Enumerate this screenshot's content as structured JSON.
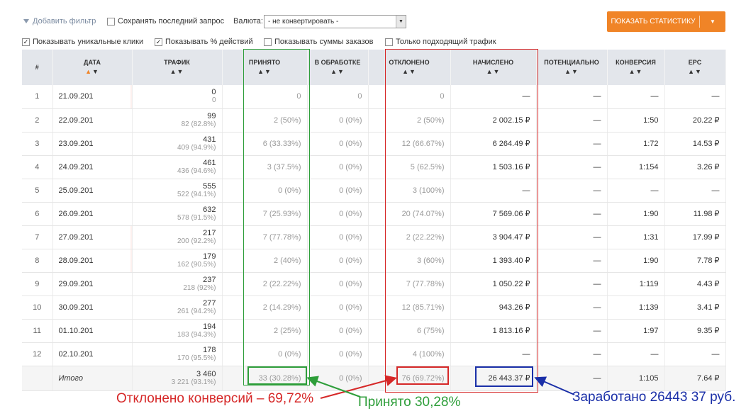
{
  "toolbar": {
    "add_filter": "Добавить фильтр",
    "save_query": "Сохранять последний запрос",
    "currency_label": "Валюта:",
    "currency_value": "- не конвертировать -",
    "show_stats": "ПОКАЗАТЬ СТАТИСТИКУ",
    "unique_clicks": "Показывать уникальные клики",
    "show_percent": "Показывать % действий",
    "show_order_sums": "Показывать суммы заказов",
    "suitable_traffic": "Только подходящий трафик"
  },
  "columns": [
    "#",
    "ДАТА",
    "ТРАФИК",
    "ПРИНЯТО",
    "В ОБРАБОТКЕ",
    "ОТКЛОНЕНО",
    "НАЧИСЛЕНО",
    "ПОТЕНЦИАЛЬНО",
    "КОНВЕРСИЯ",
    "EPC"
  ],
  "rows": [
    {
      "n": "1",
      "date": "21.09.201",
      "pink": true,
      "traffic": "0",
      "traffic_sub": "0",
      "accepted": "0",
      "processing": "0",
      "rejected": "0",
      "credited": "—",
      "potential": "—",
      "conversion": "—",
      "epc": "—"
    },
    {
      "n": "2",
      "date": "22.09.201",
      "pink": false,
      "traffic": "99",
      "traffic_sub": "82 (82.8%)",
      "accepted": "2 (50%)",
      "processing": "0 (0%)",
      "rejected": "2 (50%)",
      "credited": "2 002.15 ₽",
      "potential": "—",
      "conversion": "1:50",
      "epc": "20.22 ₽"
    },
    {
      "n": "3",
      "date": "23.09.201",
      "pink": false,
      "traffic": "431",
      "traffic_sub": "409 (94.9%)",
      "accepted": "6 (33.33%)",
      "processing": "0 (0%)",
      "rejected": "12 (66.67%)",
      "credited": "6 264.49 ₽",
      "potential": "—",
      "conversion": "1:72",
      "epc": "14.53 ₽"
    },
    {
      "n": "4",
      "date": "24.09.201",
      "pink": false,
      "traffic": "461",
      "traffic_sub": "436 (94.6%)",
      "accepted": "3 (37.5%)",
      "processing": "0 (0%)",
      "rejected": "5 (62.5%)",
      "credited": "1 503.16 ₽",
      "potential": "—",
      "conversion": "1:154",
      "epc": "3.26 ₽"
    },
    {
      "n": "5",
      "date": "25.09.201",
      "pink": false,
      "traffic": "555",
      "traffic_sub": "522 (94.1%)",
      "accepted": "0 (0%)",
      "processing": "0 (0%)",
      "rejected": "3 (100%)",
      "credited": "—",
      "potential": "—",
      "conversion": "—",
      "epc": "—"
    },
    {
      "n": "6",
      "date": "26.09.201",
      "pink": false,
      "traffic": "632",
      "traffic_sub": "578 (91.5%)",
      "accepted": "7 (25.93%)",
      "processing": "0 (0%)",
      "rejected": "20 (74.07%)",
      "credited": "7 569.06 ₽",
      "potential": "—",
      "conversion": "1:90",
      "epc": "11.98 ₽"
    },
    {
      "n": "7",
      "date": "27.09.201",
      "pink": true,
      "traffic": "217",
      "traffic_sub": "200 (92.2%)",
      "accepted": "7 (77.78%)",
      "processing": "0 (0%)",
      "rejected": "2 (22.22%)",
      "credited": "3 904.47 ₽",
      "potential": "—",
      "conversion": "1:31",
      "epc": "17.99 ₽"
    },
    {
      "n": "8",
      "date": "28.09.201",
      "pink": true,
      "traffic": "179",
      "traffic_sub": "162 (90.5%)",
      "accepted": "2 (40%)",
      "processing": "0 (0%)",
      "rejected": "3 (60%)",
      "credited": "1 393.40 ₽",
      "potential": "—",
      "conversion": "1:90",
      "epc": "7.78 ₽"
    },
    {
      "n": "9",
      "date": "29.09.201",
      "pink": false,
      "traffic": "237",
      "traffic_sub": "218 (92%)",
      "accepted": "2 (22.22%)",
      "processing": "0 (0%)",
      "rejected": "7 (77.78%)",
      "credited": "1 050.22 ₽",
      "potential": "—",
      "conversion": "1:119",
      "epc": "4.43 ₽"
    },
    {
      "n": "10",
      "date": "30.09.201",
      "pink": false,
      "traffic": "277",
      "traffic_sub": "261 (94.2%)",
      "accepted": "2 (14.29%)",
      "processing": "0 (0%)",
      "rejected": "12 (85.71%)",
      "credited": "943.26 ₽",
      "potential": "—",
      "conversion": "1:139",
      "epc": "3.41 ₽"
    },
    {
      "n": "11",
      "date": "01.10.201",
      "pink": false,
      "traffic": "194",
      "traffic_sub": "183 (94.3%)",
      "accepted": "2 (25%)",
      "processing": "0 (0%)",
      "rejected": "6 (75%)",
      "credited": "1 813.16 ₽",
      "potential": "—",
      "conversion": "1:97",
      "epc": "9.35 ₽"
    },
    {
      "n": "12",
      "date": "02.10.201",
      "pink": false,
      "traffic": "178",
      "traffic_sub": "170 (95.5%)",
      "accepted": "0 (0%)",
      "processing": "0 (0%)",
      "rejected": "4 (100%)",
      "credited": "—",
      "potential": "—",
      "conversion": "—",
      "epc": "—"
    }
  ],
  "total": {
    "label": "Итого",
    "traffic": "3 460",
    "traffic_sub": "3 221 (93.1%)",
    "accepted": "33 (30.28%)",
    "processing": "0 (0%)",
    "rejected": "76 (69.72%)",
    "credited": "26 443.37 ₽",
    "potential": "—",
    "conversion": "1:105",
    "epc": "7.64 ₽"
  },
  "annotations": {
    "rejected": "Отклонено конверсий – 69,72%",
    "accepted": "Принято 30,28%",
    "earned": "Заработано 26443 37 руб."
  },
  "colors": {
    "accent": "#f08427",
    "green": "#2e9e3a",
    "red": "#d62828",
    "blue": "#1a2fa8"
  }
}
